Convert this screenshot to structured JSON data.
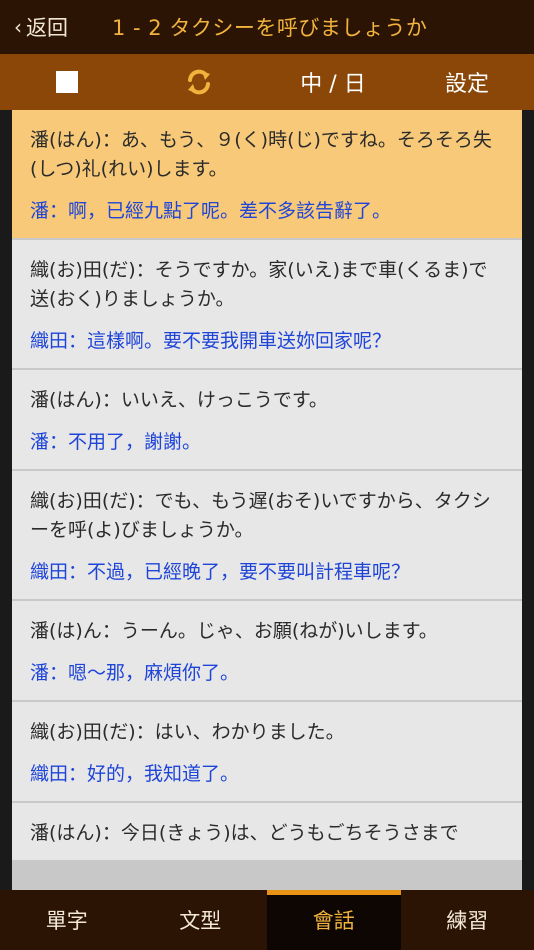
{
  "header": {
    "back_label": "返回",
    "title": "1 - 2 タクシーを呼びましょうか"
  },
  "toolbar": {
    "lang_label": "中 / 日",
    "settings_label": "設定"
  },
  "dialog": [
    {
      "jp": "潘(はん)：あ、もう、９(く)時(じ)ですね。そろそろ失(しつ)礼(れい)します。",
      "zh": "潘：啊，已經九點了呢。差不多該告辭了。",
      "active": true
    },
    {
      "jp": "織(お)田(だ)：そうですか。家(いえ)まで車(くるま)で送(おく)りましょうか。",
      "zh": "織田：這樣啊。要不要我開車送妳回家呢？"
    },
    {
      "jp": "潘(はん)：いいえ、けっこうです。",
      "zh": "潘：不用了，謝謝。"
    },
    {
      "jp": "織(お)田(だ)：でも、もう遅(おそ)いですから、タクシーを呼(よ)びましょうか。",
      "zh": "織田：不過，已經晚了，要不要叫計程車呢？"
    },
    {
      "jp": "潘(は)ん：うーん。じゃ、お願(ねが)いします。",
      "zh": "潘：嗯～那，麻煩你了。"
    },
    {
      "jp": "織(お)田(だ)：はい、わかりました。",
      "zh": "織田：好的，我知道了。"
    },
    {
      "jp": "潘(はん)：今日(きょう)は、どうもごちそうさまで",
      "zh": ""
    }
  ],
  "tabs": [
    {
      "label": "單字"
    },
    {
      "label": "文型"
    },
    {
      "label": "會話"
    },
    {
      "label": "練習"
    }
  ],
  "colors": {
    "header_bg": "#2b1404",
    "toolbar_bg": "#8a4708",
    "accent": "#f1b33d",
    "active_row": "#f7c978",
    "translation": "#1f45d8"
  }
}
